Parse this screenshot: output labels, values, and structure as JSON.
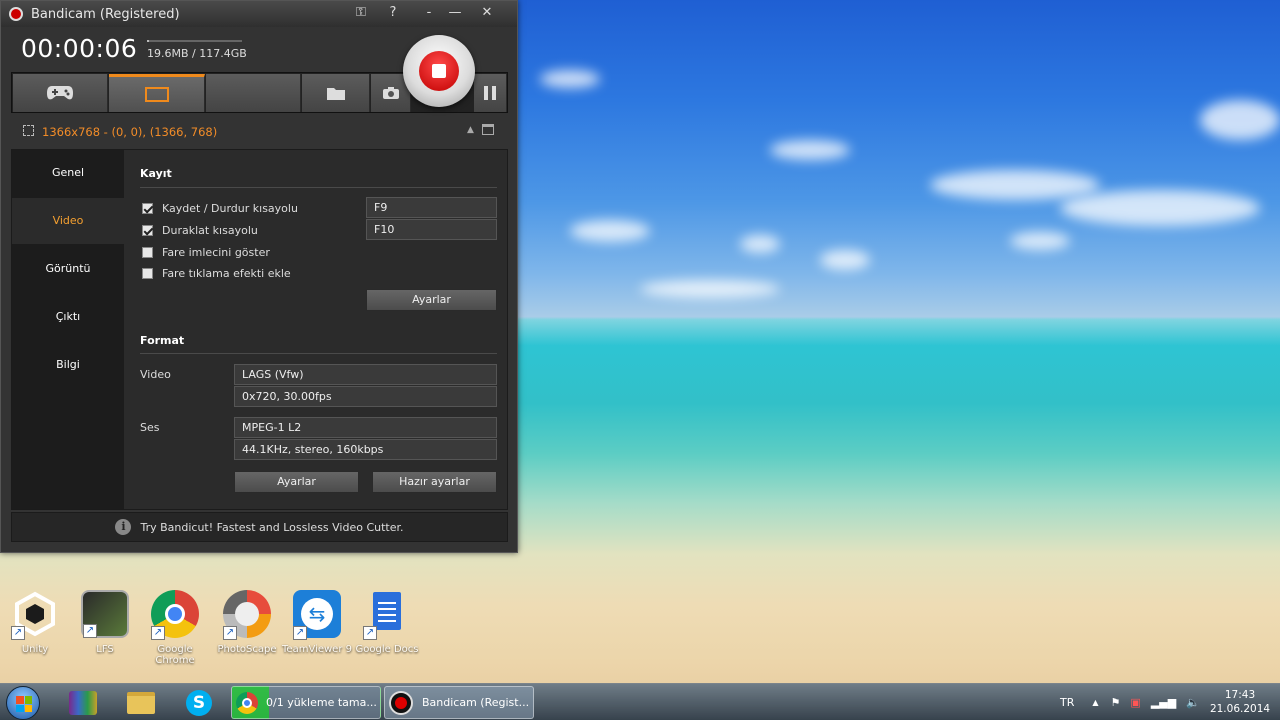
{
  "window": {
    "title": "Bandicam (Registered)",
    "timer": "00:00:06",
    "size_text": "19.6MB / 117.4GB",
    "size_fraction": 0.02,
    "controls": [
      "key-icon",
      "help-icon",
      "menu-icon",
      "minimize-icon",
      "close-icon"
    ]
  },
  "modes": {
    "tabs": [
      {
        "icon": "gamepad-icon",
        "active": false
      },
      {
        "icon": "screen-rectangle-icon",
        "active": true
      },
      {
        "icon": "blank",
        "active": false
      },
      {
        "icon": "folder-icon",
        "active": false
      },
      {
        "icon": "camera-icon",
        "active": false
      }
    ],
    "pause_icon": "pause-icon",
    "record_icon": "record-stop-icon"
  },
  "area": {
    "text": "1366x768 - (0, 0), (1366, 768)"
  },
  "sidenav": {
    "items": [
      "Genel",
      "Video",
      "Görüntü",
      "Çıktı",
      "Bilgi"
    ],
    "active": "Video"
  },
  "record": {
    "title": "Kayıt",
    "options": [
      {
        "label": "Kaydet / Durdur kısayolu",
        "checked": true,
        "hotkey": "F9"
      },
      {
        "label": "Duraklat kısayolu",
        "checked": true,
        "hotkey": "F10"
      },
      {
        "label": "Fare imlecini göster",
        "checked": false
      },
      {
        "label": "Fare tıklama efekti ekle",
        "checked": false
      }
    ],
    "settings_button": "Ayarlar"
  },
  "format": {
    "title": "Format",
    "video_label": "Video",
    "video_codec": "LAGS (Vfw)",
    "video_detail": "0x720, 30.00fps",
    "audio_label": "Ses",
    "audio_codec": "MPEG-1 L2",
    "audio_detail": "44.1KHz, stereo, 160kbps",
    "settings_button": "Ayarlar",
    "presets_button": "Hazır ayarlar"
  },
  "footer": {
    "text": "Try Bandicut! Fastest and Lossless Video Cutter."
  },
  "desktop": {
    "icons": [
      {
        "name": "Unity",
        "color": "#1b1b1b"
      },
      {
        "name": "LFS",
        "color": "#3a5a2a"
      },
      {
        "name": "Google Chrome",
        "color": "#e8e8e8"
      },
      {
        "name": "PhotoScape",
        "color": "#d8d8d8"
      },
      {
        "name": "TeamViewer 9",
        "color": "#1d7fd8"
      },
      {
        "name": "Google Docs",
        "color": "#2a6fdb"
      }
    ]
  },
  "taskbar": {
    "tasks": [
      {
        "label": "0/1 yükleme tama...",
        "progress": 0.25,
        "icon": "chrome-icon"
      },
      {
        "label": "Bandicam (Regist...",
        "icon": "bandicam-icon"
      }
    ],
    "language": "TR",
    "time": "17:43",
    "date": "21.06.2014"
  },
  "colors": {
    "accent_orange": "#f08a1c",
    "record_red": "#d00000",
    "area_text": "#f28c28"
  }
}
